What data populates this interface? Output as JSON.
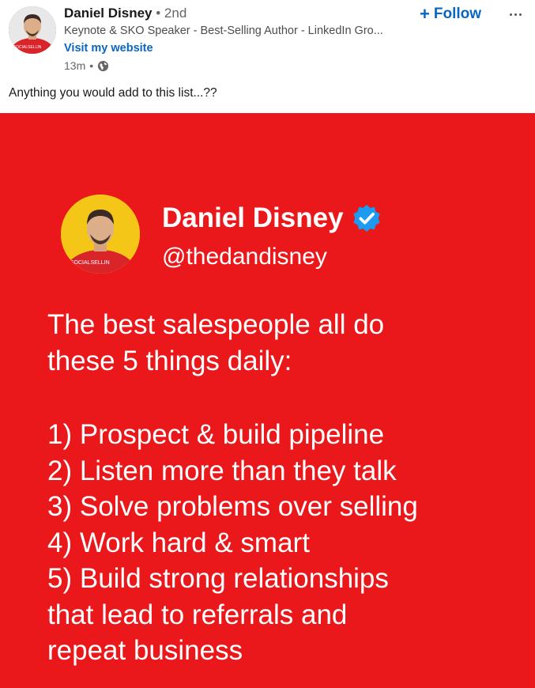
{
  "author": {
    "name": "Daniel Disney",
    "degree": "2nd",
    "headline": "Keynote & SKO Speaker - Best-Selling Author - LinkedIn Gro...",
    "website_link": "Visit my website",
    "time": "13m",
    "avatar_tag": "#SOCIALSELLIN",
    "visibility_icon": "globe-icon"
  },
  "actions": {
    "follow_label": "Follow",
    "follow_icon": "plus-icon",
    "more_icon": "more-dots-icon"
  },
  "post": {
    "text": "Anything you would add to this list...??"
  },
  "image_card": {
    "name": "Daniel Disney",
    "handle": "@thedandisney",
    "avatar_tag": "#SOCIALSELLIN",
    "verified_icon": "verified-badge-icon",
    "intro_lines": [
      "The best salespeople all do",
      "these 5 things daily:"
    ],
    "list_lines": [
      "1) Prospect & build pipeline",
      "2) Listen more than they talk",
      "3) Solve problems over selling",
      "4) Work hard & smart",
      "5) Build strong relationships",
      "that lead to referrals and",
      "repeat business"
    ]
  },
  "colors": {
    "brand_blue": "#0a66c2",
    "card_red": "#ea171b",
    "avatar_yellow": "#f3c617",
    "verified_blue": "#1d9bf0"
  }
}
